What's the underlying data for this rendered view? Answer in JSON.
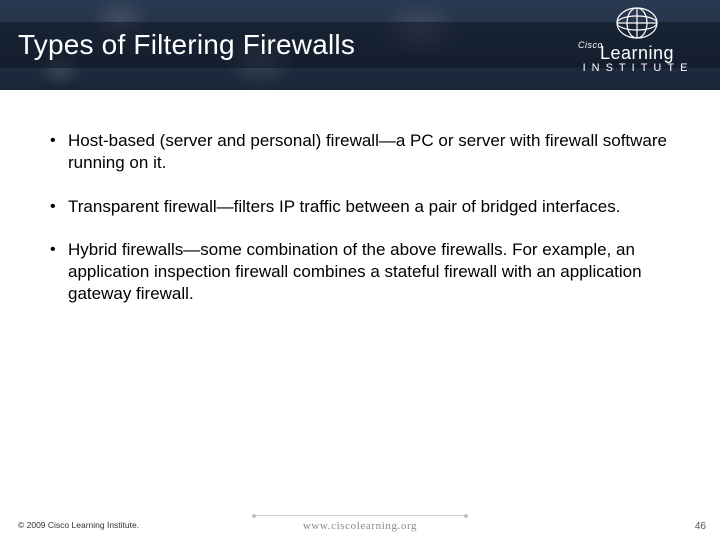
{
  "header": {
    "title": "Types of Filtering Firewalls",
    "logo": {
      "brand_small": "Cisco",
      "line1": "Learning",
      "line2": "INSTITUTE"
    }
  },
  "bullets": [
    "Host-based (server and personal) firewall—a PC or server with firewall software running on it.",
    "Transparent firewall—filters IP traffic between a pair of bridged interfaces.",
    "Hybrid firewalls—some combination of the above firewalls. For example, an application inspection firewall combines a stateful firewall with an application gateway firewall."
  ],
  "footer": {
    "copyright": "© 2009 Cisco Learning Institute.",
    "url": "www.ciscolearning.org",
    "page_number": "46"
  }
}
